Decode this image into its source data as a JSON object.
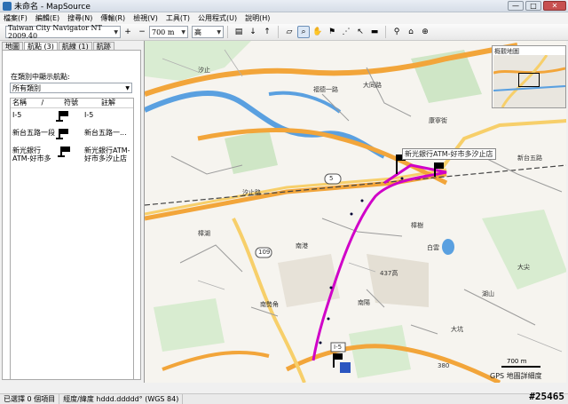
{
  "window": {
    "title": "未命名 - MapSource",
    "btn_min": "—",
    "btn_max": "□",
    "btn_close": "✕"
  },
  "menu": [
    "檔案(F)",
    "編輯(E)",
    "搜尋(N)",
    "傳輸(R)",
    "檢視(V)",
    "工具(T)",
    "公用程式(U)",
    "說明(H)"
  ],
  "toolbar": {
    "map_product": "Taiwan City Navigator NT 2009.40",
    "zoom_scale": "700 m",
    "detail_level": "高",
    "zoom_in": "+",
    "zoom_out": "−"
  },
  "tabs": [
    "地圖",
    "航點 (3)",
    "航線 (1)",
    "航跡"
  ],
  "left_panel": {
    "filter_label": "在類別中顯示航點:",
    "category": "所有類別",
    "columns": {
      "name": "名稱",
      "sort": "/",
      "symbol": "符號",
      "comment": "註解"
    },
    "rows": [
      {
        "name": "I-5",
        "comment": "I-5"
      },
      {
        "name": "新台五路一段...",
        "comment": "新台五路一..."
      },
      {
        "name": "新光銀行ATM-好市多汐止店",
        "comment": "新光銀行ATM-好市多汐止店"
      }
    ]
  },
  "map": {
    "flag_label": "新光銀行ATM-好市多汐止店",
    "road_labels": [
      "5",
      "109",
      "I-5",
      "437高",
      "福德一路",
      "新台五路",
      "南港",
      "樟樹",
      "汐止",
      "汐止路",
      "大同路",
      "康寧街",
      "南陽",
      "白雲",
      "大尖",
      "380",
      "南勢角",
      "樟湖",
      "大坑",
      "湖山"
    ],
    "route_color": "#d000c8",
    "overview_title": "概觀地圖",
    "scale_label": "700 m",
    "gps_label": "GPS 地圖詳細度"
  },
  "status": {
    "selected": "已選擇 0 個項目",
    "coord_format": "經度/緯度 hddd.ddddd° (WGS 84)"
  },
  "watermark": "#25465"
}
